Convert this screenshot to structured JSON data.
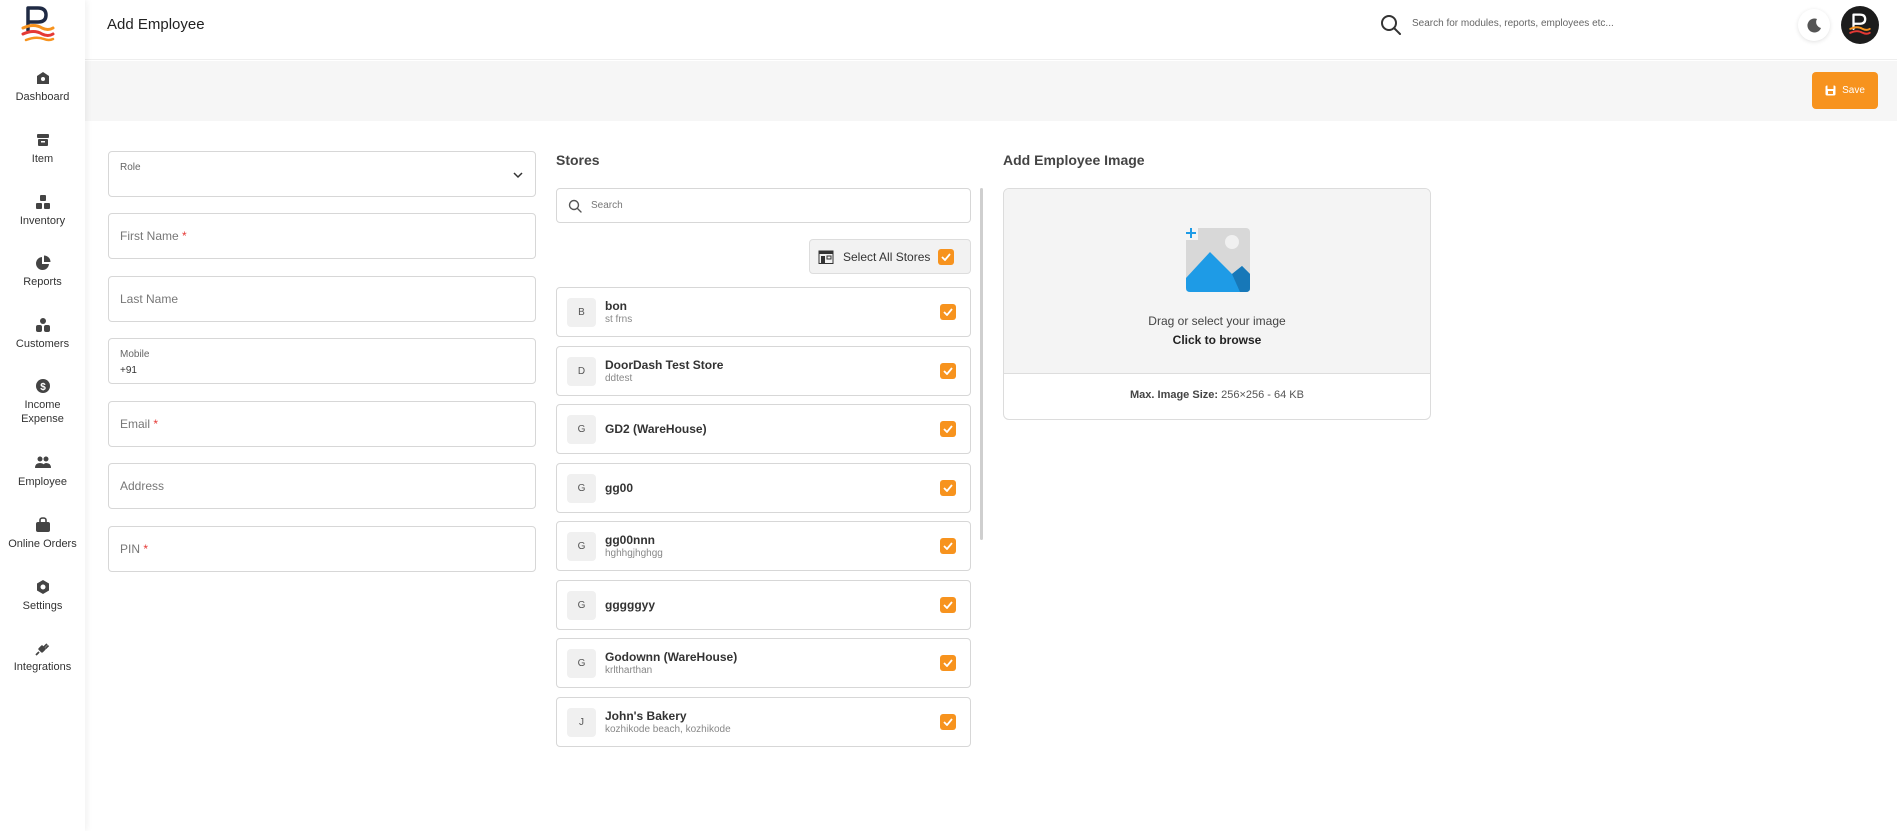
{
  "header": {
    "title": "Add Employee",
    "search_placeholder": "Search for modules, reports, employees etc..."
  },
  "sidebar": {
    "items": [
      {
        "label": "Dashboard",
        "icon": "dashboard-icon"
      },
      {
        "label": "Item",
        "icon": "item-icon"
      },
      {
        "label": "Inventory",
        "icon": "inventory-icon"
      },
      {
        "label": "Reports",
        "icon": "pie-chart-icon"
      },
      {
        "label": "Customers",
        "icon": "customers-icon"
      },
      {
        "label": "Income\nExpense",
        "icon": "dollar-icon"
      },
      {
        "label": "Employee",
        "icon": "employee-icon"
      },
      {
        "label": "Online Orders",
        "icon": "bag-icon"
      },
      {
        "label": "Settings",
        "icon": "gear-icon"
      },
      {
        "label": "Integrations",
        "icon": "plug-icon"
      }
    ]
  },
  "toolbar": {
    "save_label": "Save"
  },
  "form": {
    "role_label": "Role",
    "first_name": "First Name",
    "last_name": "Last Name",
    "mobile_label": "Mobile",
    "mobile_value": "+91",
    "email": "Email",
    "address": "Address",
    "pin": "PIN",
    "required_mark": "*"
  },
  "stores": {
    "title": "Stores",
    "search_placeholder": "Search",
    "select_all_label": "Select All Stores",
    "items": [
      {
        "letter": "B",
        "name": "bon",
        "sub": "st frns"
      },
      {
        "letter": "D",
        "name": "DoorDash Test Store",
        "sub": "ddtest"
      },
      {
        "letter": "G",
        "name": "GD2 (WareHouse)",
        "sub": ""
      },
      {
        "letter": "G",
        "name": "gg00",
        "sub": ""
      },
      {
        "letter": "G",
        "name": "gg00nnn",
        "sub": "hghhgjhghgg"
      },
      {
        "letter": "G",
        "name": "gggggyy",
        "sub": ""
      },
      {
        "letter": "G",
        "name": "Godownn (WareHouse)",
        "sub": "krltharthan"
      },
      {
        "letter": "J",
        "name": "John's Bakery",
        "sub": "kozhikode beach, kozhikode"
      }
    ]
  },
  "image_upload": {
    "title": "Add Employee Image",
    "drag_text": "Drag or select your image",
    "browse_text": "Click to browse",
    "max_label": "Max. Image Size:",
    "max_value": "256×256 - 64 KB"
  },
  "colors": {
    "accent": "#f7931e",
    "image_blue": "#1e9be6"
  }
}
